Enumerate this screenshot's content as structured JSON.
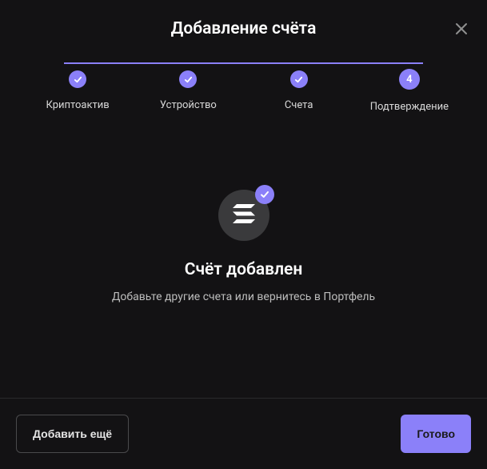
{
  "header": {
    "title": "Добавление счёта"
  },
  "stepper": {
    "steps": [
      {
        "label": "Криптоактив",
        "state": "done"
      },
      {
        "label": "Устройство",
        "state": "done"
      },
      {
        "label": "Счета",
        "state": "done"
      },
      {
        "label": "Подтверждение",
        "state": "active",
        "number": "4"
      }
    ]
  },
  "content": {
    "coin_icon": "solana-icon",
    "success_title": "Счёт добавлен",
    "success_subtitle": "Добавьте другие счета или вернитесь в Портфель"
  },
  "footer": {
    "add_more_label": "Добавить ещё",
    "done_label": "Готово"
  },
  "colors": {
    "accent": "#8b80f9",
    "background": "#131214"
  }
}
